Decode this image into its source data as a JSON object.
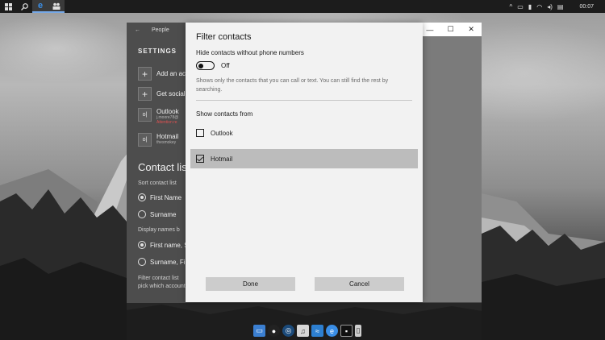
{
  "taskbar": {
    "search_icon": "search-icon",
    "edge_glyph": "e",
    "clock": "00:07"
  },
  "people_app": {
    "back_glyph": "←",
    "title": "People",
    "settings_heading": "SETTINGS",
    "add_account": "Add an ac",
    "get_social": "Get social",
    "outlook_name": "Outlook",
    "outlook_sub": "j.moore78@",
    "outlook_warning": "Attention re",
    "hotmail_name": "Hotmail",
    "hotmail_sub": "thesmokey",
    "contact_list_heading": "Contact list",
    "sort_label": "Sort contact list",
    "sort_first": "First Name",
    "sort_surname": "Surname",
    "display_label": "Display names b",
    "display_first": "First name, S",
    "display_surname": "Surname, Fi",
    "filter_label": "Filter contact list",
    "filter_sub": "pick which account"
  },
  "window_controls": {
    "minimize": "—",
    "maximize": "☐",
    "close": "✕"
  },
  "dialog": {
    "title": "Filter contacts",
    "hide_label": "Hide contacts without phone numbers",
    "toggle_state": "Off",
    "help_text": "Shows only the contacts that you can call or text. You can still find the rest by searching.",
    "show_from_label": "Show contacts from",
    "sources": [
      {
        "label": "Outlook",
        "checked": false
      },
      {
        "label": "Hotmail",
        "checked": true
      }
    ],
    "done_label": "Done",
    "cancel_label": "Cancel"
  },
  "colors": {
    "accent": "#3a8ee6",
    "selection": "#bcbcbc",
    "dialog_bg": "#f2f2f2"
  }
}
